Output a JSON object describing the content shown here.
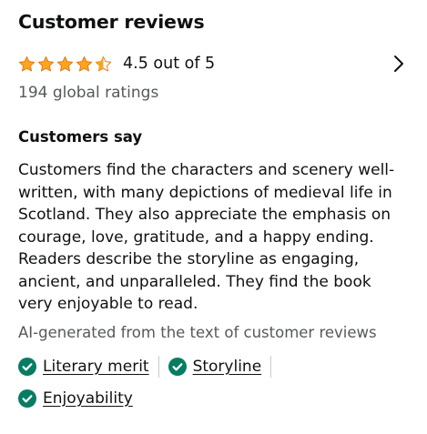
{
  "header": {
    "title": "Customer reviews"
  },
  "rating": {
    "value": 4.5,
    "max": 5,
    "text": "4.5 out of 5",
    "star_color": "#ffa41c",
    "star_outline": "#de7921"
  },
  "global_ratings": {
    "text": "194 global ratings"
  },
  "customers_say": {
    "heading": "Customers say",
    "summary": "Customers find the characters and scenery well-written, with many depictions of medieval life in Scotland. They also appreciate the emphasis on courage, love, gratitude, and a happy ending. Readers describe the storyline as engaging, ancient, and unparalleled. They find the book very enjoyable to read.",
    "ai_note": "AI-generated from the text of customer reviews"
  },
  "aspects": [
    {
      "label": "Literary merit",
      "icon": "check-circle-icon",
      "color": "#067d62"
    },
    {
      "label": "Storyline",
      "icon": "check-circle-icon",
      "color": "#067d62"
    },
    {
      "label": "Enjoyability",
      "icon": "check-circle-icon",
      "color": "#067d62"
    }
  ],
  "navigation": {
    "icon": "chevron-right-icon"
  }
}
